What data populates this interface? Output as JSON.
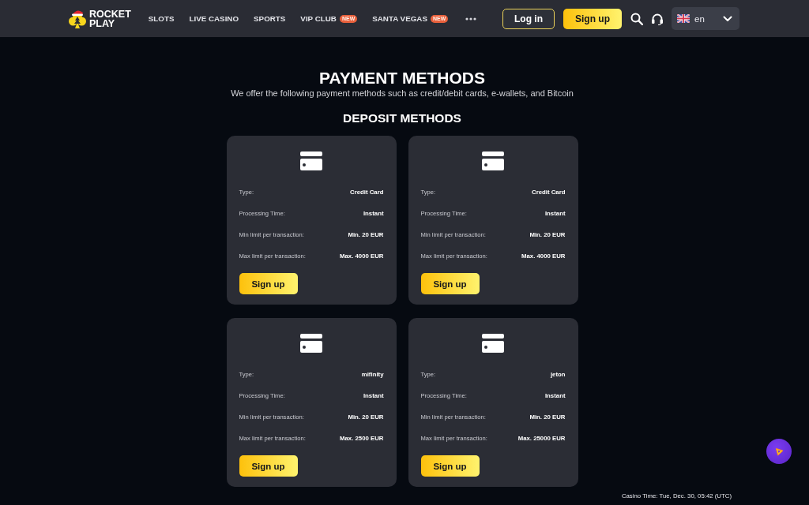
{
  "header": {
    "logo": {
      "line_1": "ROCKET",
      "line_2": "PLAY"
    },
    "nav": [
      {
        "label": "SLOTS"
      },
      {
        "label": "LIVE CASINO"
      },
      {
        "label": "SPORTS"
      },
      {
        "label": "VIP CLUB",
        "badge": "NEW"
      },
      {
        "label": "SANTA VEGAS",
        "badge": "NEW"
      }
    ],
    "login_button": "Log in",
    "signup_button": "Sign up",
    "language_select": {
      "value": "en"
    }
  },
  "page": {
    "title": "PAYMENT METHODS",
    "subtitle": "We offer the following payment methods such as credit/debit cards, e-wallets, and Bitcoin",
    "section_title": "DEPOSIT METHODS"
  },
  "methods": [
    {
      "fields": [
        {
          "label": "Type:",
          "value": "Credit Card"
        },
        {
          "label": "Processing Time:",
          "value": "Instant"
        },
        {
          "label": "Min limit per transaction:",
          "value": "Min. 20 EUR"
        },
        {
          "label": "Max limit per transaction:",
          "value": "Max. 4000 EUR"
        }
      ],
      "button": "Sign up"
    },
    {
      "fields": [
        {
          "label": "Type:",
          "value": "Credit Card"
        },
        {
          "label": "Processing Time:",
          "value": "Instant"
        },
        {
          "label": "Min limit per transaction:",
          "value": "Min. 20 EUR"
        },
        {
          "label": "Max limit per transaction:",
          "value": "Max. 4000 EUR"
        }
      ],
      "button": "Sign up"
    },
    {
      "fields": [
        {
          "label": "Type:",
          "value": "mifinity"
        },
        {
          "label": "Processing Time:",
          "value": "Instant"
        },
        {
          "label": "Min limit per transaction:",
          "value": "Min. 20 EUR"
        },
        {
          "label": "Max limit per transaction:",
          "value": "Max. 2500 EUR"
        }
      ],
      "button": "Sign up"
    },
    {
      "fields": [
        {
          "label": "Type:",
          "value": "jeton"
        },
        {
          "label": "Processing Time:",
          "value": "Instant"
        },
        {
          "label": "Min limit per transaction:",
          "value": "Min. 20 EUR"
        },
        {
          "label": "Max limit per transaction:",
          "value": "Max. 25000 EUR"
        }
      ],
      "button": "Sign up"
    }
  ],
  "casino_time": "Casino Time: Tue, Dec. 30, 05:42 (UTC)"
}
